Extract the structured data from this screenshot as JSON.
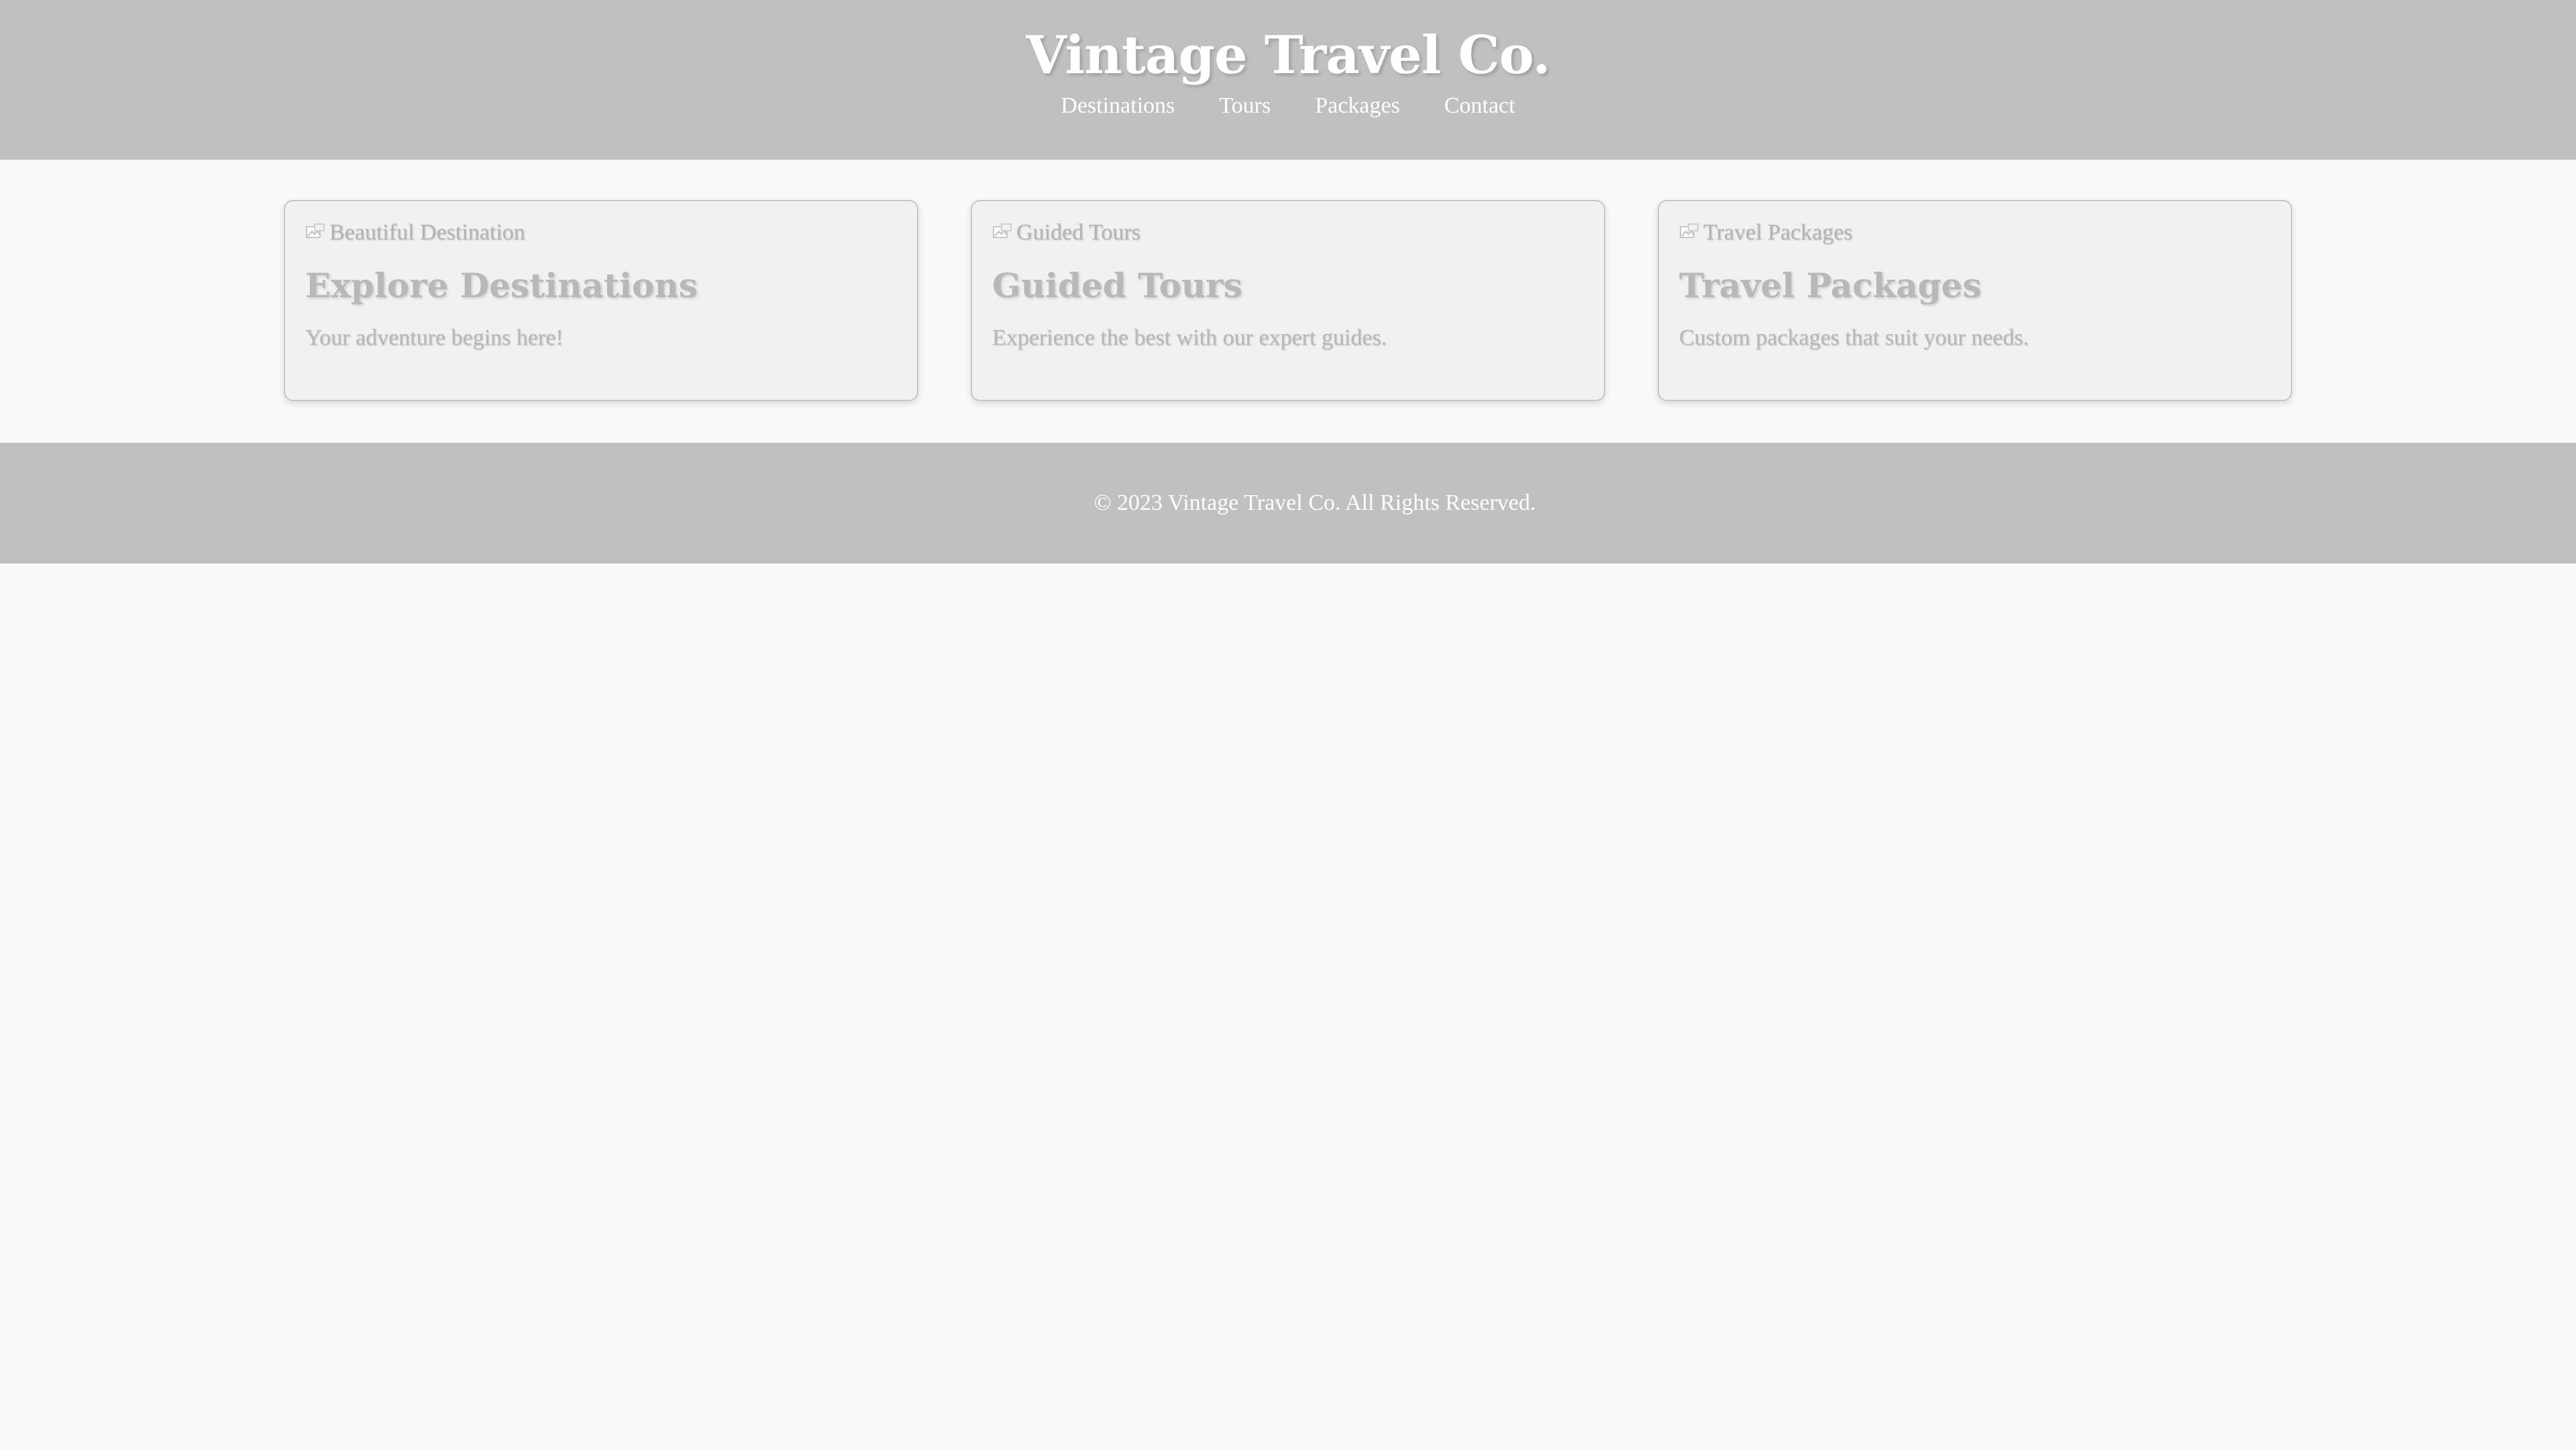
{
  "header": {
    "title": "Vintage Travel Co.",
    "nav": [
      "Destinations",
      "Tours",
      "Packages",
      "Contact"
    ]
  },
  "cards": [
    {
      "image_alt": "Beautiful Destination",
      "title": "Explore Destinations",
      "description": "Your adventure begins here!"
    },
    {
      "image_alt": "Guided Tours",
      "title": "Guided Tours",
      "description": "Experience the best with our expert guides."
    },
    {
      "image_alt": "Travel Packages",
      "title": "Travel Packages",
      "description": "Custom packages that suit your needs."
    }
  ],
  "footer": {
    "copyright": "© 2023 Vintage Travel Co. All Rights Reserved."
  },
  "colors": {
    "header_bg": "#c0c0c0",
    "page_bg": "#f9f9f9",
    "card_bg": "#f1f1f1",
    "muted_text": "#b8b8b8"
  }
}
